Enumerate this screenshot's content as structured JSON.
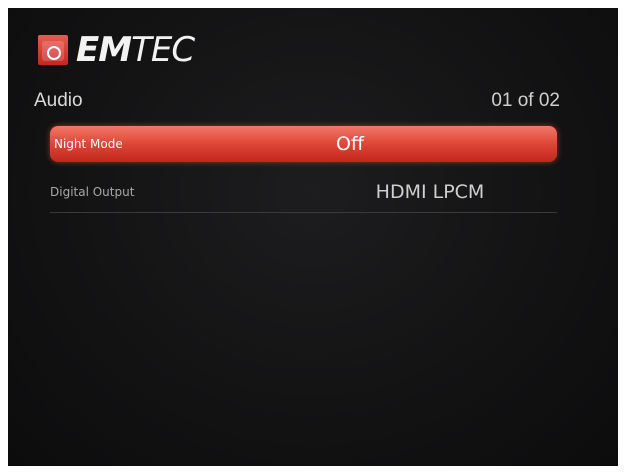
{
  "brand": {
    "name_bold": "EM",
    "name_light": "TEC",
    "logo_icon": "emtec-logo-icon",
    "accent_color": "#e04a3a"
  },
  "header": {
    "title": "Audio",
    "page_counter": "01 of 02"
  },
  "menu": {
    "items": [
      {
        "label": "Night Mode",
        "value": "Off",
        "selected": true
      },
      {
        "label": "Digital Output",
        "value": "HDMI LPCM",
        "selected": false
      }
    ]
  }
}
